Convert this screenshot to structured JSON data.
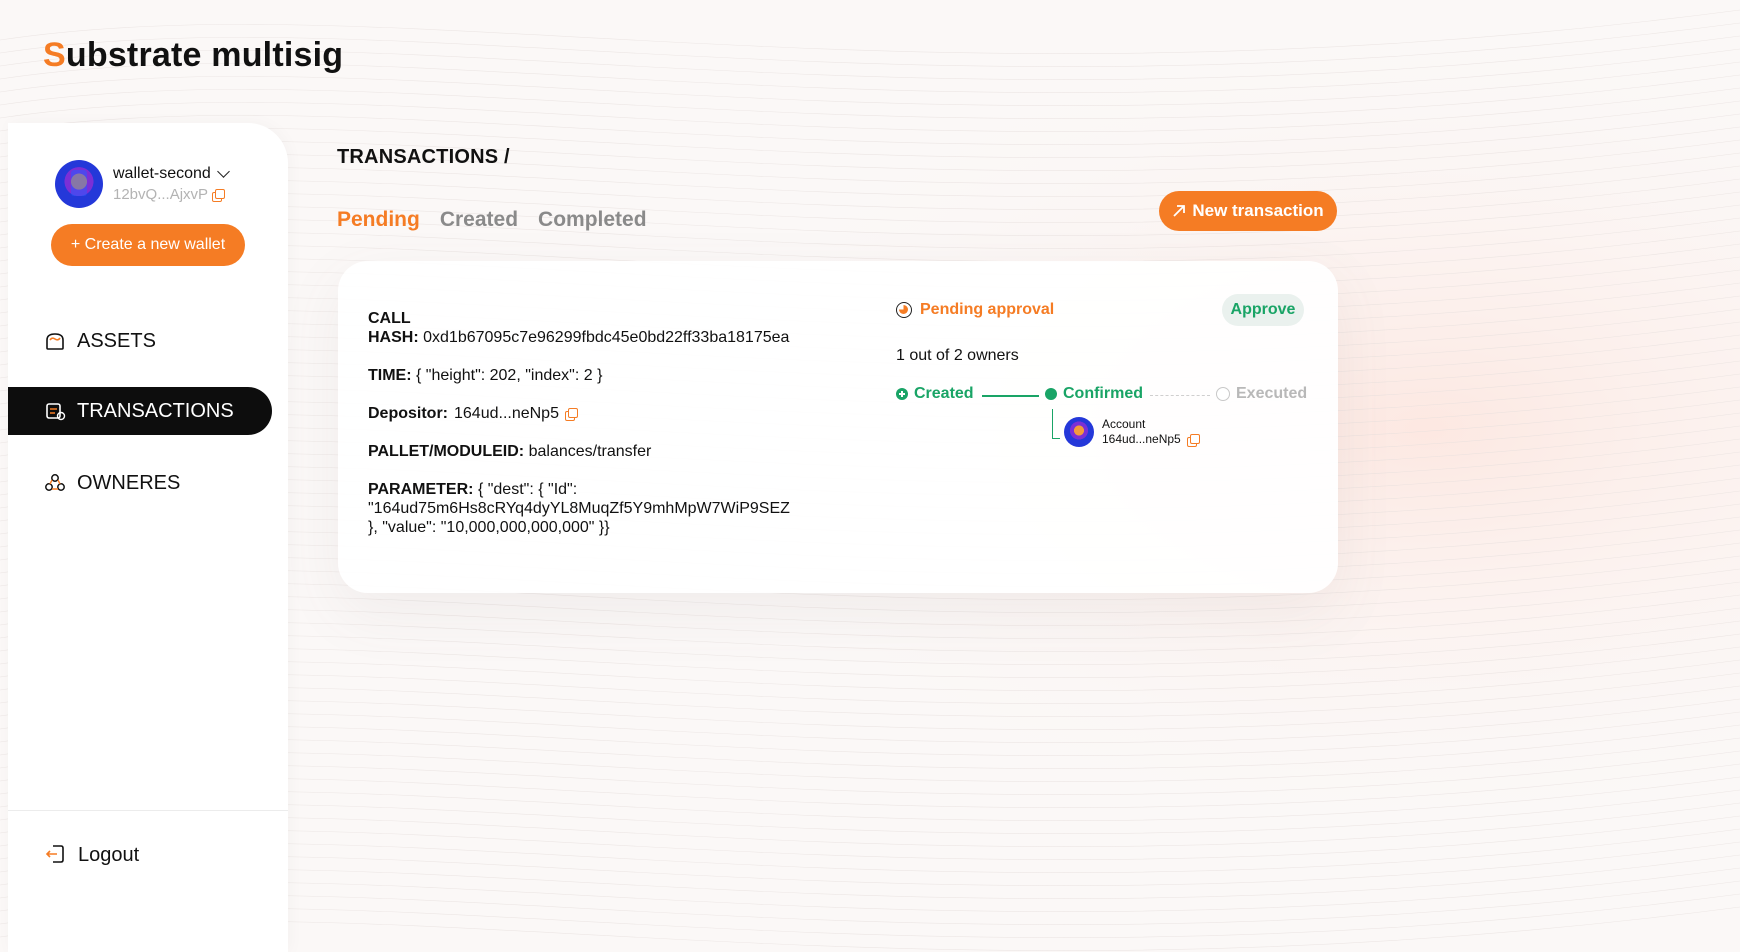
{
  "brand": {
    "first_letter": "S",
    "rest": "ubstrate multisig"
  },
  "sidebar": {
    "wallet_name": "wallet-second",
    "wallet_address": "12bvQ...AjxvP",
    "create_wallet_label": "+ Create a new wallet",
    "nav": [
      {
        "label": "ASSETS",
        "icon": "assets-icon",
        "active": false
      },
      {
        "label": "TRANSACTIONS",
        "icon": "transactions-icon",
        "active": true
      },
      {
        "label": "OWNERES",
        "icon": "owners-icon",
        "active": false
      }
    ],
    "logout_label": "Logout"
  },
  "header": {
    "breadcrumb": "TRANSACTIONS /",
    "tabs": [
      "Pending",
      "Created",
      "Completed"
    ],
    "active_tab": "Pending",
    "new_tx_label": "New transaction"
  },
  "transaction": {
    "call_label": "CALL",
    "hash_label": "HASH:",
    "hash_value": "0xd1b67095c7e96299fbdc45e0bd22ff33ba18175ea",
    "time_label": "TIME:",
    "time_value": "{ \"height\": 202, \"index\": 2 }",
    "depositor_label": "Depositor:",
    "depositor_value": "164ud...neNp5",
    "pallet_label": "PALLET/MODULEID:",
    "pallet_value": "balances/transfer",
    "parameter_label": "PARAMETER:",
    "parameter_line1": "{ \"dest\": { \"Id\":",
    "parameter_line2": "\"164ud75m6Hs8cRYq4dyYL8MuqZf5Y9mhMpW7WiP9SEZ",
    "parameter_line3": "}, \"value\": \"10,000,000,000,000\" }}",
    "status": "Pending approval",
    "approve_label": "Approve",
    "owners_count": "1 out of 2 owners",
    "steps": [
      {
        "label": "Created",
        "state": "done"
      },
      {
        "label": "Confirmed",
        "state": "done"
      },
      {
        "label": "Executed",
        "state": "todo"
      }
    ],
    "signer": {
      "label": "Account",
      "address": "164ud...neNp5"
    }
  },
  "colors": {
    "accent": "#f57c24",
    "success": "#19a466",
    "muted": "#b8b8b8",
    "active_nav_bg": "#0d0d0d"
  }
}
